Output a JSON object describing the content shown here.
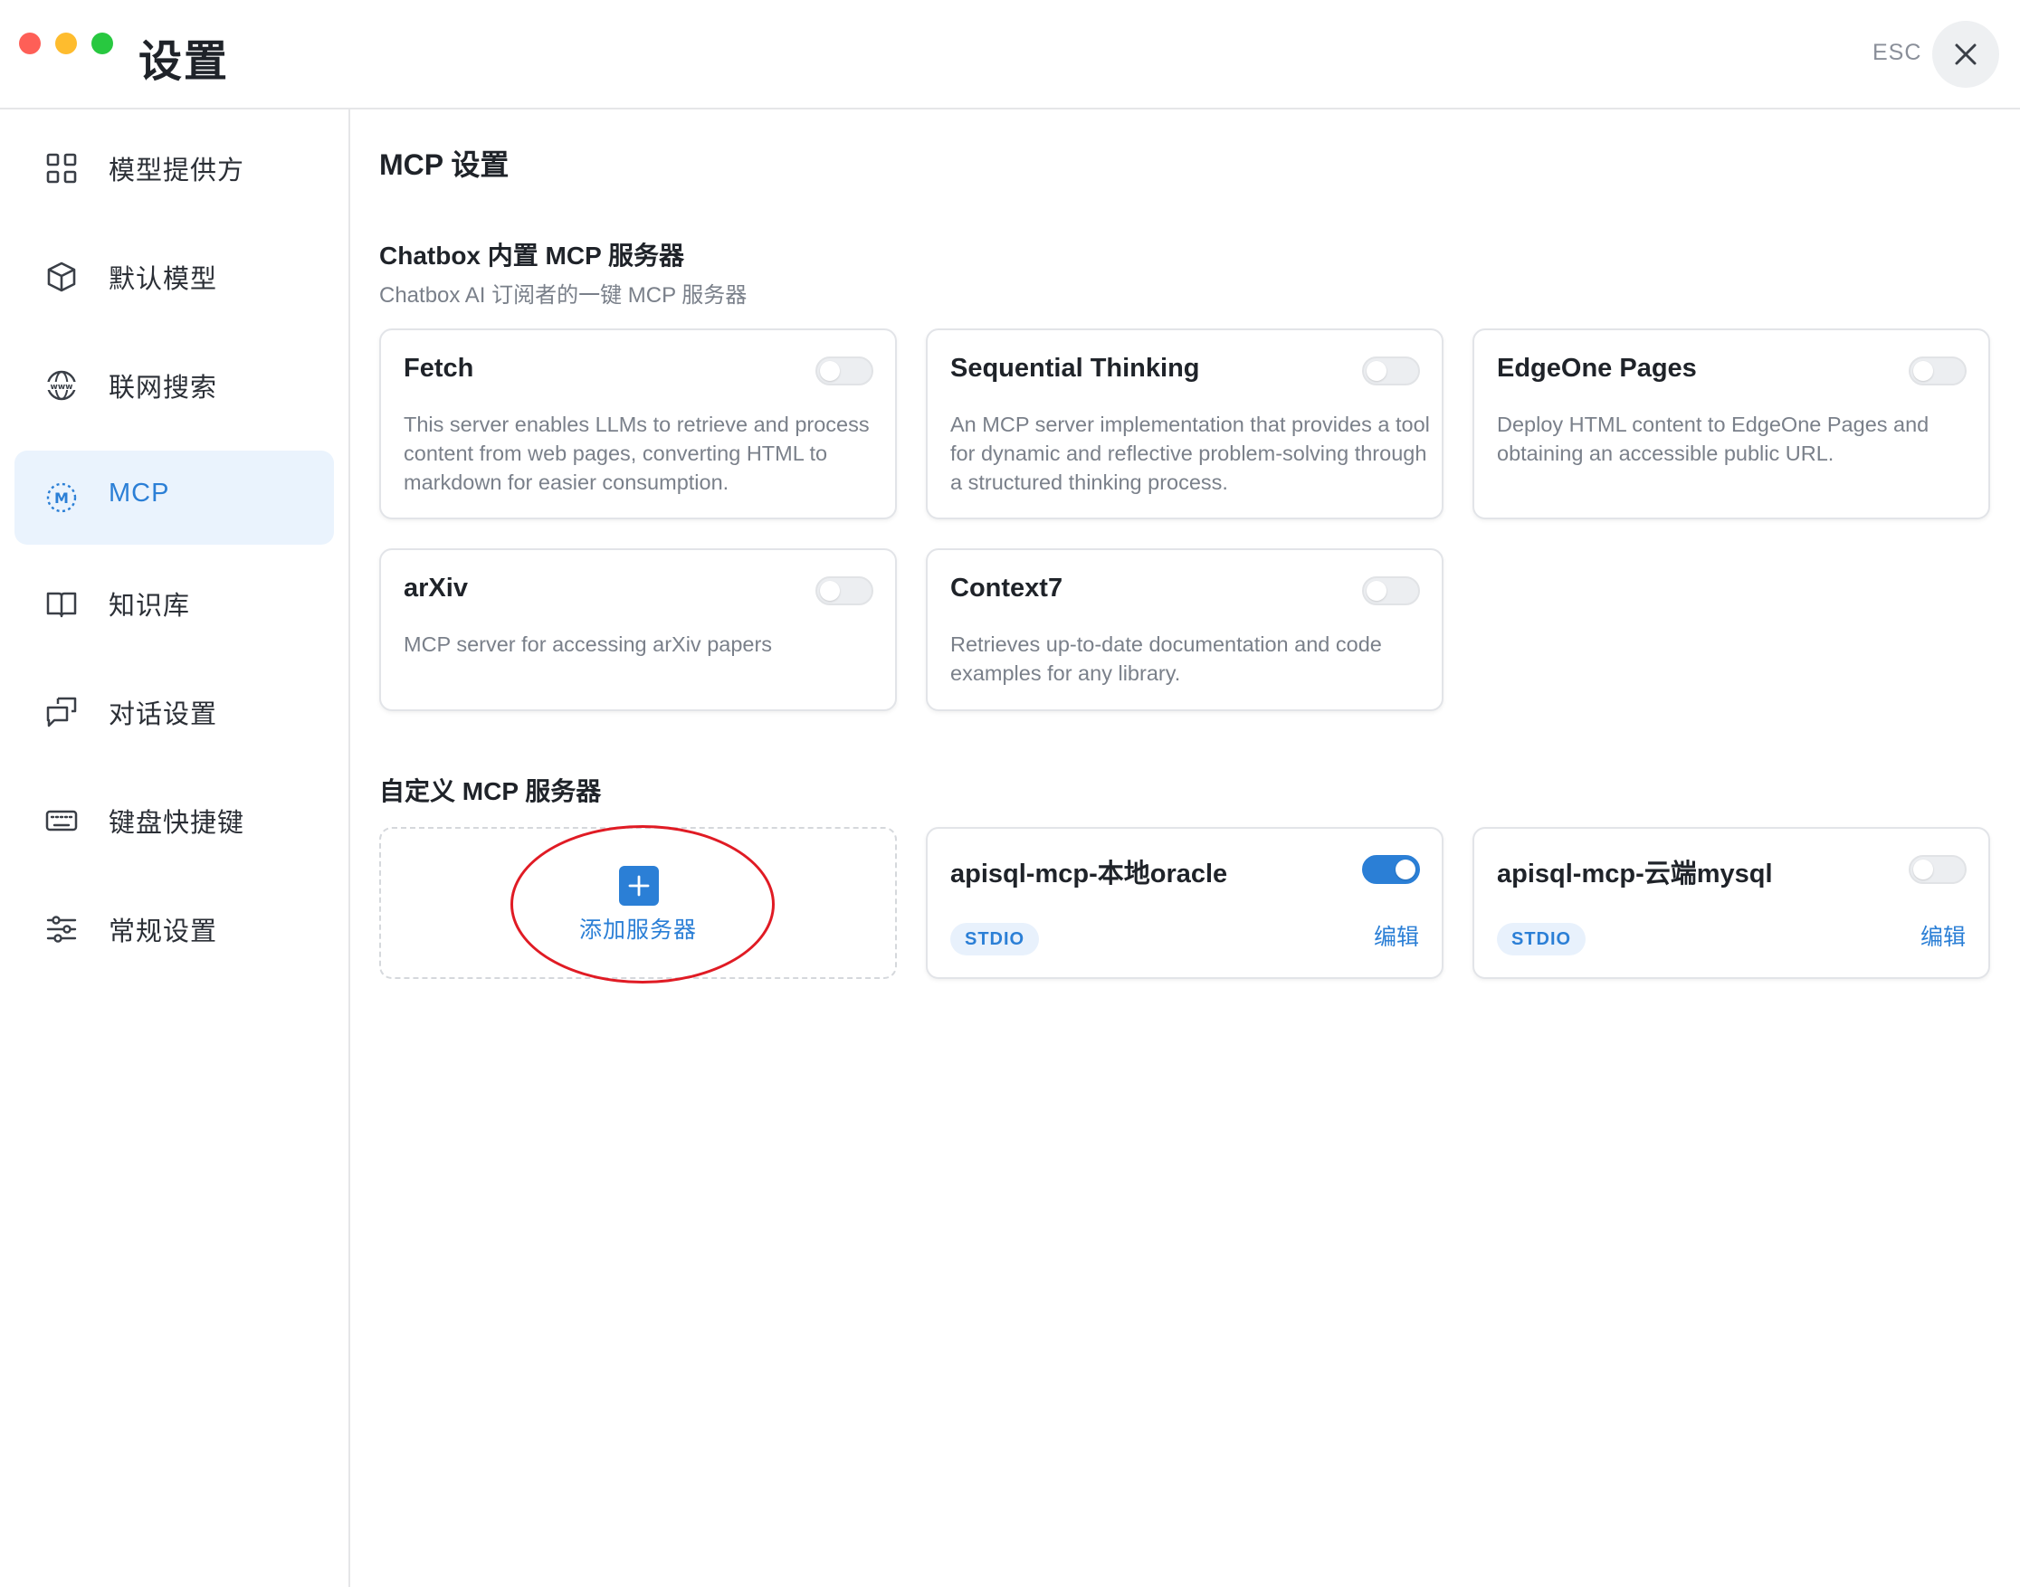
{
  "window": {
    "title": "设置",
    "esc_label": "ESC"
  },
  "sidebar": {
    "items": [
      {
        "label": "模型提供方",
        "icon": "grid-icon"
      },
      {
        "label": "默认模型",
        "icon": "cube-icon"
      },
      {
        "label": "联网搜索",
        "icon": "globe-www-icon"
      },
      {
        "label": "MCP",
        "icon": "mcp-icon",
        "active": true
      },
      {
        "label": "知识库",
        "icon": "book-icon"
      },
      {
        "label": "对话设置",
        "icon": "chat-icon"
      },
      {
        "label": "键盘快捷键",
        "icon": "keyboard-icon"
      },
      {
        "label": "常规设置",
        "icon": "sliders-icon"
      }
    ]
  },
  "main": {
    "title": "MCP 设置",
    "builtin": {
      "title": "Chatbox 内置 MCP 服务器",
      "subtitle": "Chatbox AI 订阅者的一键 MCP 服务器",
      "servers": [
        {
          "name": "Fetch",
          "desc": "This server enables LLMs to retrieve and process content from web pages, converting HTML to markdown for easier consumption.",
          "enabled": false
        },
        {
          "name": "Sequential Thinking",
          "desc": "An MCP server implementation that provides a tool for dynamic and reflective problem-solving through a structured thinking process.",
          "enabled": false
        },
        {
          "name": "EdgeOne Pages",
          "desc": "Deploy HTML content to EdgeOne Pages and obtaining an accessible public URL.",
          "enabled": false
        },
        {
          "name": "arXiv",
          "desc": "MCP server for accessing arXiv papers",
          "enabled": false
        },
        {
          "name": "Context7",
          "desc": "Retrieves up-to-date documentation and code examples for any library.",
          "enabled": false
        }
      ]
    },
    "custom": {
      "title": "自定义 MCP 服务器",
      "add_label": "添加服务器",
      "servers": [
        {
          "name": "apisql-mcp-本地oracle",
          "type": "STDIO",
          "edit_label": "编辑",
          "enabled": true
        },
        {
          "name": "apisql-mcp-云端mysql",
          "type": "STDIO",
          "edit_label": "编辑",
          "enabled": false
        }
      ]
    }
  },
  "colors": {
    "accent": "#2b7fd6",
    "active_bg": "#eaf3fd",
    "annotation": "#e01b24"
  }
}
